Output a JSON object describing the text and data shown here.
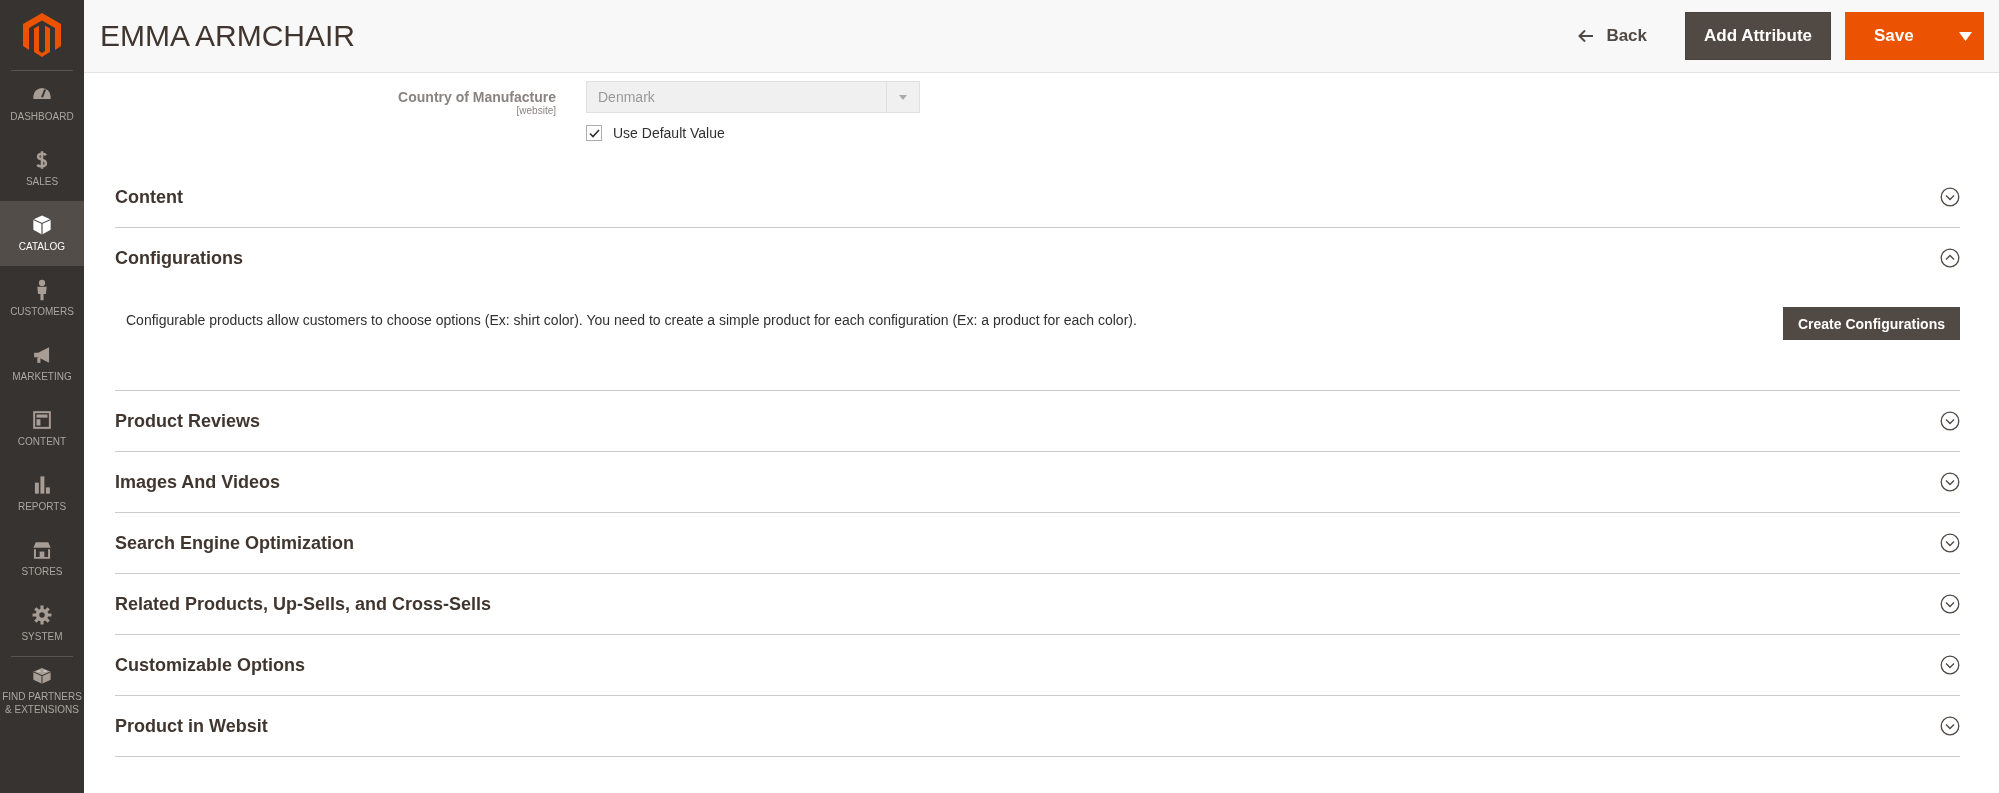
{
  "sidebar": {
    "items": [
      {
        "label": "DASHBOARD",
        "selected": false
      },
      {
        "label": "SALES",
        "selected": false
      },
      {
        "label": "CATALOG",
        "selected": true
      },
      {
        "label": "CUSTOMERS",
        "selected": false
      },
      {
        "label": "MARKETING",
        "selected": false
      },
      {
        "label": "CONTENT",
        "selected": false
      },
      {
        "label": "REPORTS",
        "selected": false
      },
      {
        "label": "STORES",
        "selected": false
      },
      {
        "label": "SYSTEM",
        "selected": false
      },
      {
        "label": "FIND PARTNERS & EXTENSIONS",
        "selected": false
      }
    ]
  },
  "header": {
    "title": "EMMA ARMCHAIR",
    "back": "Back",
    "add_attribute": "Add Attribute",
    "save": "Save"
  },
  "field": {
    "label": "Country of Manufacture",
    "scope": "[website]",
    "value": "Denmark",
    "disabled": true,
    "use_default": {
      "label": "Use Default Value",
      "checked": true
    }
  },
  "sections": [
    {
      "title": "Content",
      "expanded": false
    },
    {
      "title": "Configurations",
      "expanded": true,
      "description": "Configurable products allow customers to choose options (Ex: shirt color). You need to create a simple product for each configuration (Ex: a product for each color).",
      "button": "Create Configurations"
    },
    {
      "title": "Product Reviews",
      "expanded": false
    },
    {
      "title": "Images And Videos",
      "expanded": false
    },
    {
      "title": "Search Engine Optimization",
      "expanded": false
    },
    {
      "title": "Related Products, Up-Sells, and Cross-Sells",
      "expanded": false
    },
    {
      "title": "Customizable Options",
      "expanded": false
    },
    {
      "title": "Product in Websit",
      "expanded": false
    }
  ]
}
